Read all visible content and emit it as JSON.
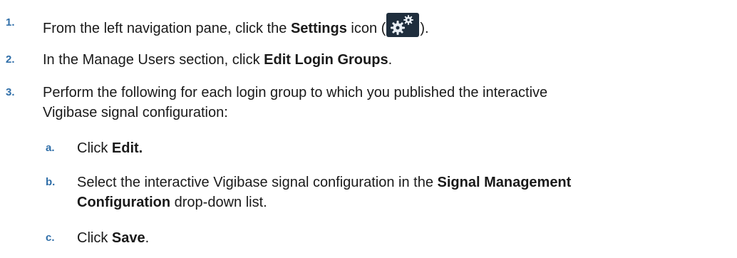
{
  "steps": [
    {
      "number": "1.",
      "before": "From the left navigation pane, click the ",
      "bold": "Settings",
      "after_icon_prefix": " icon (",
      "after_icon_suffix": ").",
      "icon": "gear-icon"
    },
    {
      "number": "2.",
      "before": "In the Manage Users section, click ",
      "bold": "Edit Login Groups",
      "after": "."
    },
    {
      "number": "3.",
      "line1": "Perform the following for each login group to which you published the interactive",
      "line2": "Vigibase signal configuration:"
    }
  ],
  "substeps": [
    {
      "letter": "a.",
      "before": "Click ",
      "bold": "Edit."
    },
    {
      "letter": "b.",
      "before": "Select the interactive Vigibase signal configuration in the ",
      "bold1": "Signal Management",
      "bold2": "Configuration",
      "after": " drop-down list."
    },
    {
      "letter": "c.",
      "before": "Click ",
      "bold": "Save",
      "after": "."
    }
  ]
}
